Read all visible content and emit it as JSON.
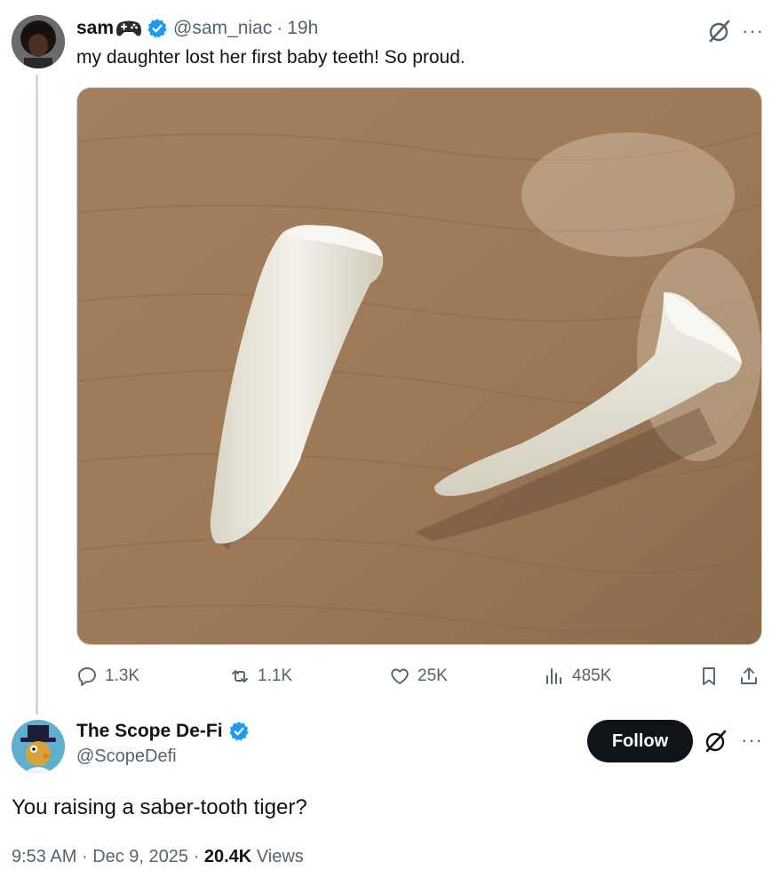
{
  "tweet": {
    "author_name": "sam",
    "author_emoji": "game-controller-icon",
    "handle": "@sam_niac",
    "separator": "·",
    "time": "19h",
    "text": "my daughter lost her first baby teeth! So proud.",
    "image_icon": "two-white-fang-teeth-photo",
    "stats": {
      "replies": "1.3K",
      "reposts": "1.1K",
      "likes": "25K",
      "views": "485K"
    }
  },
  "reply": {
    "author_name": "The Scope De-Fi",
    "handle": "@ScopeDefi",
    "follow_label": "Follow",
    "text": "You raising a saber-tooth tiger?",
    "time": "9:53 AM",
    "date": "Dec 9, 2025",
    "separator": "·",
    "views_count": "20.4K",
    "views_label": "Views"
  },
  "colors": {
    "verified": "#1d9bf0",
    "secondary_text": "#536471",
    "primary_text": "#0f1419",
    "follow_bg": "#0f1419",
    "thread_line": "#cfd9de"
  }
}
